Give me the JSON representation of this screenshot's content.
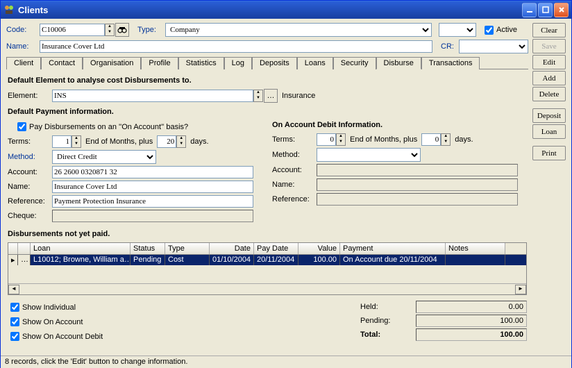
{
  "window": {
    "title": "Clients"
  },
  "hdr": {
    "code_lbl": "Code:",
    "code": "C10006",
    "type_lbl": "Type:",
    "type": "Company",
    "active_lbl": "Active",
    "name_lbl": "Name:",
    "name": "Insurance Cover Ltd",
    "cr_lbl": "CR:"
  },
  "tabs": [
    "Client",
    "Contact",
    "Organisation",
    "Profile",
    "Statistics",
    "Log",
    "Deposits",
    "Loans",
    "Security",
    "Disburse",
    "Transactions"
  ],
  "active_tab": "Disburse",
  "disb": {
    "head1": "Default Element to analyse cost Disbursements to.",
    "elem_lbl": "Element:",
    "elem_code": "INS",
    "elem_name": "Insurance",
    "head2": "Default Payment information.",
    "onacct_lbl": "Pay Disbursements on an ''On Account'' basis?",
    "terms_lbl": "Terms:",
    "terms1_n": "1",
    "terms_mid": "End of Months, plus",
    "terms1_d": "20",
    "days_lbl": "days.",
    "method_lbl": "Method:",
    "method": "Direct Credit",
    "acct_lbl": "Account:",
    "acct": "26 2600 0320871 32",
    "name_lbl": "Name:",
    "name": "Insurance Cover Ltd",
    "ref_lbl": "Reference:",
    "ref": "Payment Protection Insurance",
    "cheque_lbl": "Cheque:",
    "head3": "On Account Debit Information.",
    "terms2_n": "0",
    "terms2_d": "0",
    "grid_head": "Disbursements not yet paid.",
    "cols": [
      "",
      "",
      "Loan",
      "Status",
      "Type",
      "Date",
      "Pay Date",
      "Value",
      "Payment",
      "Notes"
    ],
    "row": {
      "loan": "L10012; Browne, William a…",
      "status": "Pending",
      "type": "Cost",
      "date": "01/10/2004",
      "paydate": "20/11/2004",
      "value": "100.00",
      "payment": "On Account due 20/11/2004",
      "notes": ""
    },
    "filters": {
      "showind": "Show Individual",
      "showacct": "Show On Account",
      "showacctd": "Show On Account Debit"
    },
    "totals": {
      "held_lbl": "Held:",
      "held": "0.00",
      "pend_lbl": "Pending:",
      "pend": "100.00",
      "total_lbl": "Total:",
      "total": "100.00"
    }
  },
  "btns": {
    "clear": "Clear",
    "save": "Save",
    "edit": "Edit",
    "add": "Add",
    "delete": "Delete",
    "deposit": "Deposit",
    "loan": "Loan",
    "print": "Print"
  },
  "status": "8 records, click the 'Edit' button to change information."
}
